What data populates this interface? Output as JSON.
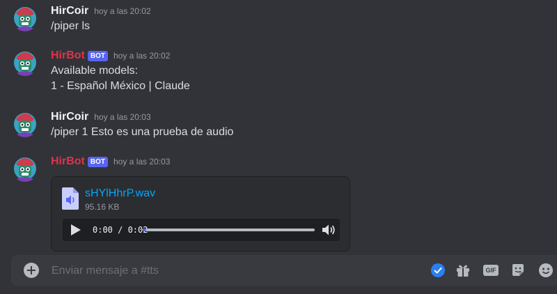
{
  "messages": [
    {
      "author": "HirCoir",
      "is_bot": false,
      "timestamp": "hoy a las 20:02",
      "lines": [
        "/piper ls"
      ]
    },
    {
      "author": "HirBot",
      "is_bot": true,
      "bot_tag": "BOT",
      "timestamp": "hoy a las 20:02",
      "lines": [
        "Available models:",
        "1 - Español México | Claude"
      ]
    },
    {
      "author": "HirCoir",
      "is_bot": false,
      "timestamp": "hoy a las 20:03",
      "lines": [
        "/piper 1 Esto es una prueba de audio"
      ]
    },
    {
      "author": "HirBot",
      "is_bot": true,
      "bot_tag": "BOT",
      "timestamp": "hoy a las 20:03",
      "attachment": {
        "file_icon": "audio-file-icon",
        "file_name": "sHYlHhrP.wav",
        "file_size": "95.16 KB",
        "player": {
          "time": "0:00 / 0:02",
          "progress_fraction": 0.02,
          "play_icon": "play-icon",
          "volume_icon": "volume-icon"
        }
      }
    }
  ],
  "composer": {
    "placeholder": "Enviar mensaje a #tts",
    "icons": [
      "add-icon",
      "checkmark-icon",
      "gift-icon",
      "gif-icon",
      "sticker-icon",
      "emoji-icon"
    ],
    "gif_label": "GIF"
  },
  "colors": {
    "bot_name": "#e1324a",
    "bot_tag": "#5865f2",
    "link": "#00a8fc",
    "background": "#313338"
  }
}
